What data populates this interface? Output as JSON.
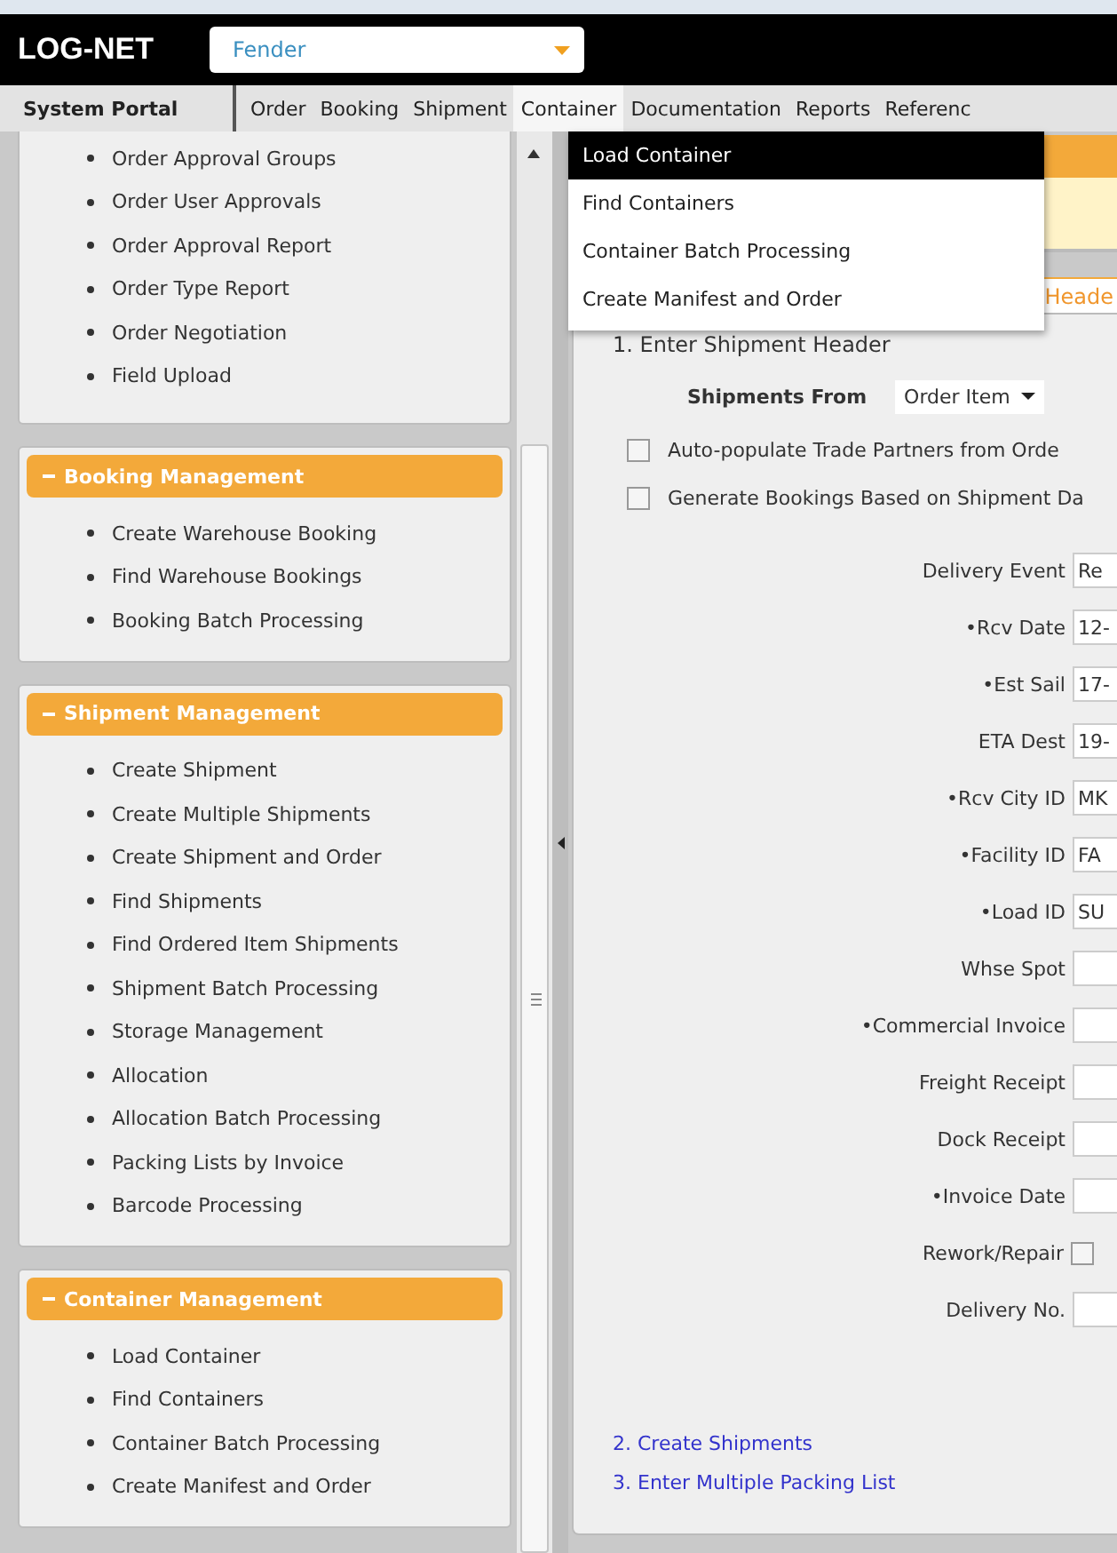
{
  "header": {
    "logo": "LOG-NET",
    "company_select": {
      "value": "Fender"
    }
  },
  "menu_bar": {
    "portal": "System Portal",
    "menus": [
      {
        "label": "Order",
        "selected": false
      },
      {
        "label": "Booking",
        "selected": false
      },
      {
        "label": "Shipment",
        "selected": false
      },
      {
        "label": "Container",
        "selected": true
      },
      {
        "label": "Documentation",
        "selected": false
      },
      {
        "label": "Reports",
        "selected": false
      },
      {
        "label": "Referenc",
        "selected": false
      }
    ]
  },
  "dropdown_menu": {
    "items": [
      {
        "label": "Load Container",
        "selected": true
      },
      {
        "label": "Find Containers",
        "selected": false
      },
      {
        "label": "Container Batch Processing",
        "selected": false
      },
      {
        "label": "Create Manifest and Order",
        "selected": false
      }
    ]
  },
  "sidebar": {
    "sections": [
      {
        "items": [
          "Order Approval Groups",
          "Order User Approvals",
          "Order Approval Report",
          "Order Type Report",
          "Order Negotiation",
          "Field Upload"
        ]
      },
      {
        "title": "Booking Management",
        "expanded": true,
        "items": [
          "Create Warehouse Booking",
          "Find Warehouse Bookings",
          "Booking Batch Processing"
        ]
      },
      {
        "title": "Shipment Management",
        "expanded": true,
        "items": [
          "Create Shipment",
          "Create Multiple Shipments",
          "Create Shipment and Order",
          "Find Shipments",
          "Find Ordered Item Shipments",
          "Shipment Batch Processing",
          "Storage Management",
          "Allocation",
          "Allocation Batch Processing",
          "Packing Lists by Invoice",
          "Barcode Processing"
        ]
      },
      {
        "title": "Container Management",
        "expanded": true,
        "items": [
          "Load Container",
          "Find Containers",
          "Container Batch Processing",
          "Create Manifest and Order"
        ]
      }
    ]
  },
  "panel": {
    "tab": "Heade",
    "step_title": "1. Enter Shipment Header",
    "shipments_from": {
      "label": "Shipments From",
      "value": "Order Item"
    },
    "options": [
      {
        "label": "Auto-populate Trade Partners from Orde",
        "checked": false
      },
      {
        "label": "Generate Bookings Based on Shipment Da",
        "checked": false
      }
    ],
    "fields": [
      {
        "kind": "text",
        "label": "Delivery Event",
        "value": "Re"
      },
      {
        "kind": "text",
        "label": "•Rcv Date",
        "value": "12-"
      },
      {
        "kind": "text",
        "label": "•Est Sail",
        "value": "17-"
      },
      {
        "kind": "text",
        "label": "ETA Dest",
        "value": "19-"
      },
      {
        "kind": "text",
        "label": "•Rcv City ID",
        "value": "MK"
      },
      {
        "kind": "text",
        "label": "•Facility ID",
        "value": "FA"
      },
      {
        "kind": "text",
        "label": "•Load ID",
        "value": "SU"
      },
      {
        "kind": "text",
        "label": "Whse Spot"
      },
      {
        "kind": "text",
        "label": "•Commercial Invoice"
      },
      {
        "kind": "text",
        "label": "Freight Receipt"
      },
      {
        "kind": "text",
        "label": "Dock Receipt"
      },
      {
        "kind": "text",
        "label": "•Invoice Date"
      },
      {
        "kind": "checkbox",
        "label": "Rework/Repair",
        "checked": false
      },
      {
        "kind": "text",
        "label": "Delivery No."
      }
    ],
    "links": [
      "2. Create Shipments",
      "3. Enter Multiple Packing List"
    ]
  }
}
